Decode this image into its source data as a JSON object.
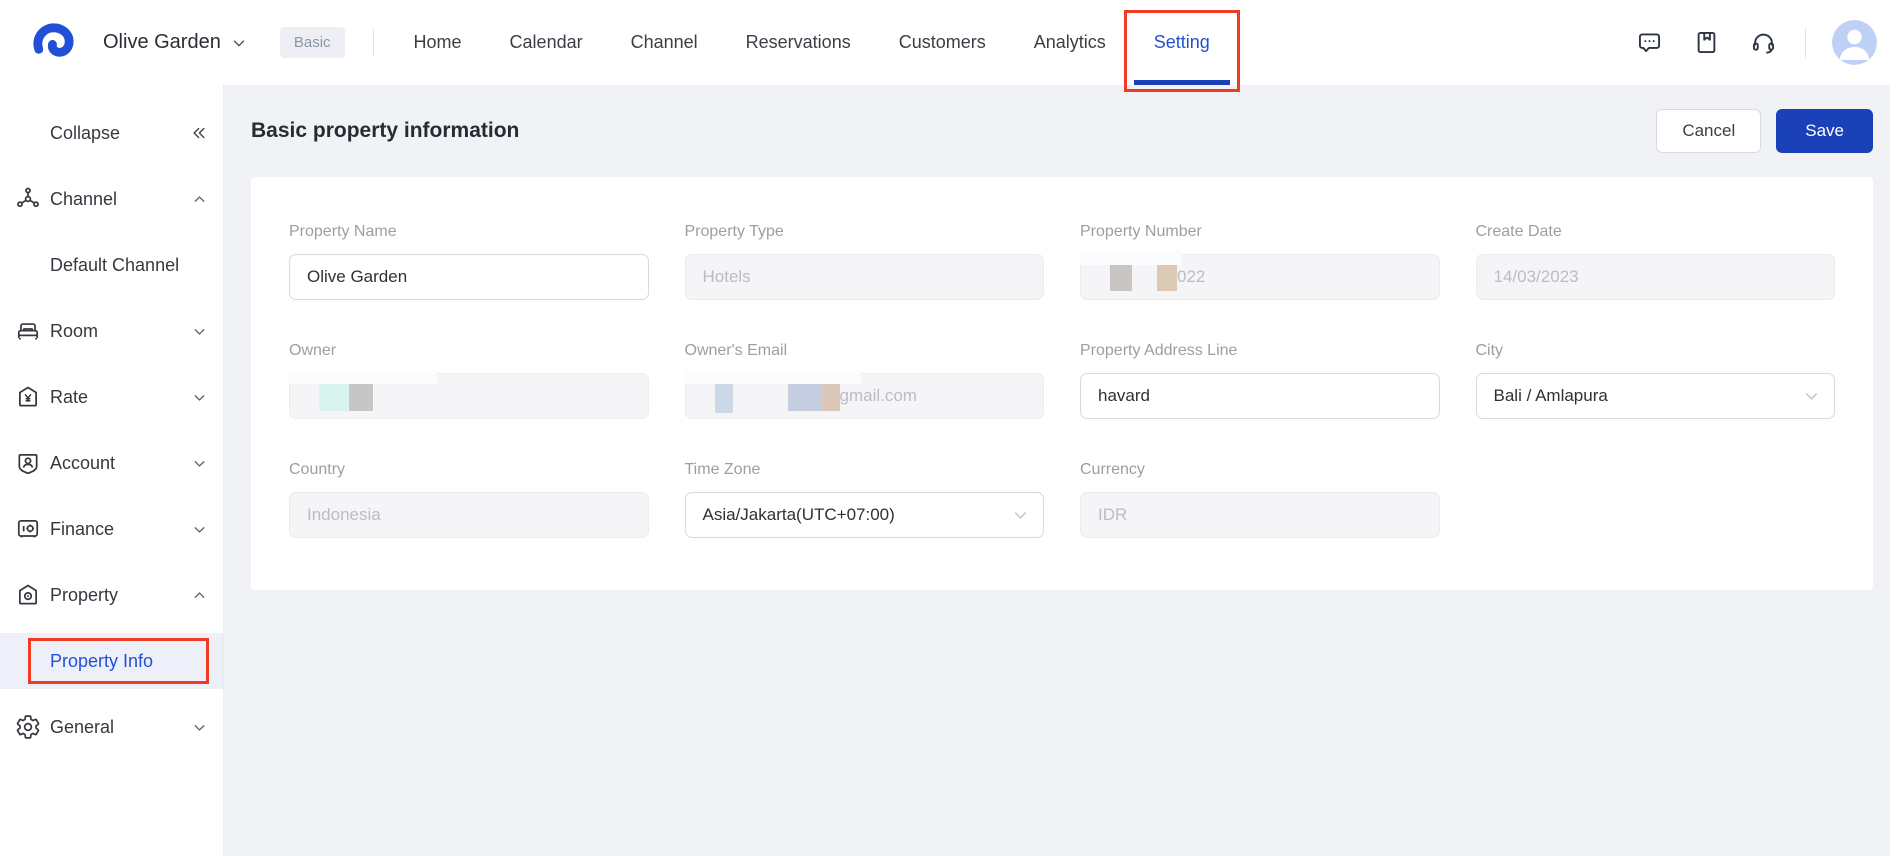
{
  "app": {
    "property_switcher": {
      "label": "Olive Garden"
    },
    "plan_badge": "Basic",
    "nav_items": [
      {
        "label": "Home",
        "active": false
      },
      {
        "label": "Calendar",
        "active": false
      },
      {
        "label": "Channel",
        "active": false
      },
      {
        "label": "Reservations",
        "active": false
      },
      {
        "label": "Customers",
        "active": false
      },
      {
        "label": "Analytics",
        "active": false
      },
      {
        "label": "Setting",
        "active": true,
        "annotated": true
      }
    ],
    "header_icons": [
      {
        "name": "chat-icon"
      },
      {
        "name": "bookmark-icon"
      },
      {
        "name": "headset-icon"
      },
      {
        "name": "avatar"
      }
    ]
  },
  "sidebar": {
    "collapse_label": "Collapse",
    "items": [
      {
        "label": "Channel",
        "icon": "channel-icon",
        "expanded": true
      },
      {
        "label": "Default Channel",
        "type": "sub-item",
        "selected": false
      },
      {
        "label": "Room",
        "icon": "room-icon",
        "expanded": false
      },
      {
        "label": "Rate",
        "icon": "rate-icon",
        "expanded": false
      },
      {
        "label": "Account",
        "icon": "account-icon",
        "expanded": false
      },
      {
        "label": "Finance",
        "icon": "finance-icon",
        "expanded": false
      },
      {
        "label": "Property",
        "icon": "property-icon",
        "expanded": true
      },
      {
        "label": "Property Info",
        "type": "sub-item",
        "selected": true,
        "annotated": true
      },
      {
        "label": "General",
        "icon": "general-icon",
        "expanded": false
      }
    ]
  },
  "page": {
    "title": "Basic property information",
    "actions": {
      "cancel": "Cancel",
      "save": "Save"
    }
  },
  "form": {
    "fields": [
      {
        "label": "Property Name",
        "value": "Olive Garden",
        "state": "editable"
      },
      {
        "label": "Property Type",
        "value": "Hotels",
        "state": "disabled"
      },
      {
        "label": "Property Number",
        "visible_suffix": "022",
        "state": "disabled",
        "redacted": true
      },
      {
        "label": "Create Date",
        "value": "14/03/2023",
        "state": "disabled"
      },
      {
        "label": "Owner",
        "value": "",
        "state": "disabled",
        "redacted": true
      },
      {
        "label": "Owner's Email",
        "visible_suffix": "gmail.com",
        "state": "disabled",
        "redacted": true
      },
      {
        "label": "Property Address Line",
        "value": "havard",
        "state": "editable"
      },
      {
        "label": "City",
        "value": "Bali / Amlapura",
        "state": "select"
      },
      {
        "label": "Country",
        "value": "Indonesia",
        "state": "disabled"
      },
      {
        "label": "Time Zone",
        "value": "Asia/Jakarta(UTC+07:00)",
        "state": "select"
      },
      {
        "label": "Currency",
        "value": "IDR",
        "state": "disabled"
      }
    ]
  },
  "colors": {
    "accent_blue": "#1b41b8",
    "active_text_blue": "#2150d5",
    "annotation_red": "#ee3b22",
    "logo_blue": "#2150d6",
    "avatar_bg": "#bfd0f6",
    "redaction_gray": "#c9c5c2",
    "redaction_tan": "#ddc9b8",
    "redaction_cyan": "#d9f4ef",
    "redaction_blue_gray": "#cdd8e9"
  }
}
